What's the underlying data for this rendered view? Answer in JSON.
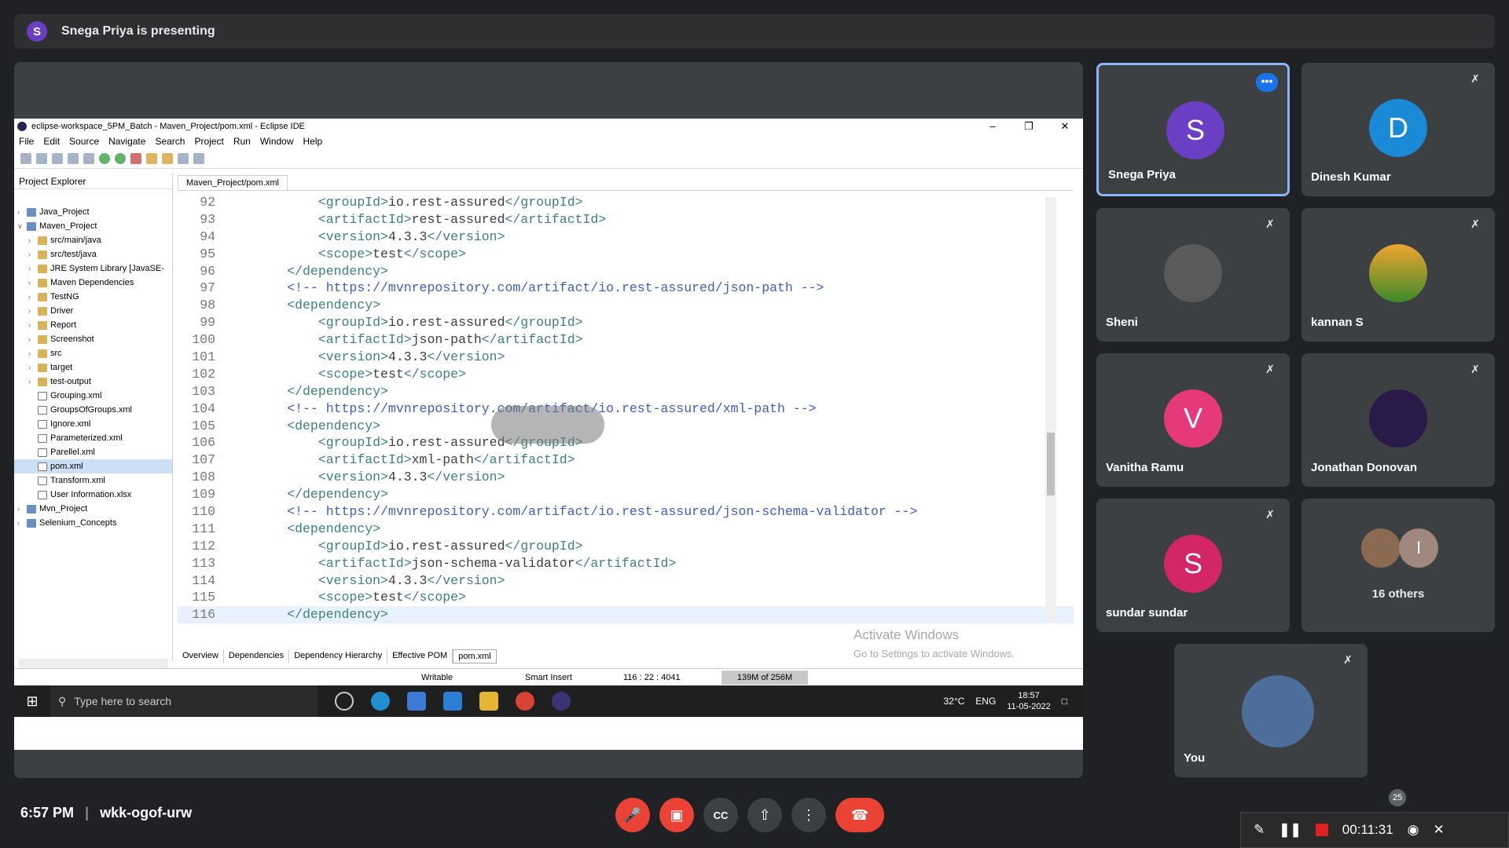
{
  "banner": {
    "avatar_letter": "S",
    "text": "Snega Priya is presenting"
  },
  "eclipse": {
    "title": "eclipse-workspace_5PM_Batch - Maven_Project/pom.xml - Eclipse IDE",
    "menu": [
      "File",
      "Edit",
      "Source",
      "Navigate",
      "Search",
      "Project",
      "Run",
      "Window",
      "Help"
    ],
    "explorer_title": "Project Explorer",
    "tree": [
      {
        "label": "Java_Project",
        "level": 0,
        "icon": "project"
      },
      {
        "label": "Maven_Project",
        "level": 0,
        "icon": "project"
      },
      {
        "label": "src/main/java",
        "level": 1,
        "icon": "package"
      },
      {
        "label": "src/test/java",
        "level": 1,
        "icon": "package"
      },
      {
        "label": "JRE System Library [JavaSE-",
        "level": 1,
        "icon": "library"
      },
      {
        "label": "Maven Dependencies",
        "level": 1,
        "icon": "library"
      },
      {
        "label": "TestNG",
        "level": 1,
        "icon": "library"
      },
      {
        "label": "Driver",
        "level": 1,
        "icon": "folder"
      },
      {
        "label": "Report",
        "level": 1,
        "icon": "folder"
      },
      {
        "label": "Screenshot",
        "level": 1,
        "icon": "folder"
      },
      {
        "label": "src",
        "level": 1,
        "icon": "folder"
      },
      {
        "label": "target",
        "level": 1,
        "icon": "folder"
      },
      {
        "label": "test-output",
        "level": 1,
        "icon": "folder"
      },
      {
        "label": "Grouping.xml",
        "level": 1,
        "icon": "file"
      },
      {
        "label": "GroupsOfGroups.xml",
        "level": 1,
        "icon": "file"
      },
      {
        "label": "Ignore.xml",
        "level": 1,
        "icon": "file"
      },
      {
        "label": "Parameterized.xml",
        "level": 1,
        "icon": "file"
      },
      {
        "label": "Parellel.xml",
        "level": 1,
        "icon": "file"
      },
      {
        "label": "pom.xml",
        "level": 1,
        "icon": "file",
        "selected": true
      },
      {
        "label": "Transform.xml",
        "level": 1,
        "icon": "file"
      },
      {
        "label": "User Information.xlsx",
        "level": 1,
        "icon": "file"
      },
      {
        "label": "Mvn_Project",
        "level": 0,
        "icon": "project"
      },
      {
        "label": "Selenium_Concepts",
        "level": 0,
        "icon": "project"
      }
    ],
    "editor_tab": "Maven_Project/pom.xml",
    "code": [
      {
        "n": "92",
        "t": "            <groupId>io.rest-assured</groupId>"
      },
      {
        "n": "93",
        "t": "            <artifactId>rest-assured</artifactId>"
      },
      {
        "n": "94",
        "t": "            <version>4.3.3</version>"
      },
      {
        "n": "95",
        "t": "            <scope>test</scope>"
      },
      {
        "n": "96",
        "t": "        </dependency>"
      },
      {
        "n": "97",
        "t": "        <!-- https://mvnrepository.com/artifact/io.rest-assured/json-path -->"
      },
      {
        "n": "98",
        "t": "        <dependency>"
      },
      {
        "n": "99",
        "t": "            <groupId>io.rest-assured</groupId>"
      },
      {
        "n": "100",
        "t": "            <artifactId>json-path</artifactId>"
      },
      {
        "n": "101",
        "t": "            <version>4.3.3</version>"
      },
      {
        "n": "102",
        "t": "            <scope>test</scope>"
      },
      {
        "n": "103",
        "t": "        </dependency>"
      },
      {
        "n": "104",
        "t": "        <!-- https://mvnrepository.com/artifact/io.rest-assured/xml-path -->"
      },
      {
        "n": "105",
        "t": "        <dependency>"
      },
      {
        "n": "106",
        "t": "            <groupId>io.rest-assured</groupId>"
      },
      {
        "n": "107",
        "t": "            <artifactId>xml-path</artifactId>"
      },
      {
        "n": "108",
        "t": "            <version>4.3.3</version>"
      },
      {
        "n": "109",
        "t": "        </dependency>"
      },
      {
        "n": "110",
        "t": "        <!-- https://mvnrepository.com/artifact/io.rest-assured/json-schema-validator -->"
      },
      {
        "n": "111",
        "t": "        <dependency>"
      },
      {
        "n": "112",
        "t": "            <groupId>io.rest-assured</groupId>"
      },
      {
        "n": "113",
        "t": "            <artifactId>json-schema-validator</artifactId>"
      },
      {
        "n": "114",
        "t": "            <version>4.3.3</version>"
      },
      {
        "n": "115",
        "t": "            <scope>test</scope>"
      },
      {
        "n": "116",
        "t": "        </dependency>"
      }
    ],
    "bottom_tabs": [
      "Overview",
      "Dependencies",
      "Dependency Hierarchy",
      "Effective POM",
      "pom.xml"
    ],
    "status": {
      "mode": "Writable",
      "insert": "Smart Insert",
      "position": "116 : 22 : 4041",
      "memory": "139M of 256M"
    },
    "watermark": {
      "title": "Activate Windows",
      "sub": "Go to Settings to activate Windows."
    }
  },
  "taskbar": {
    "search_placeholder": "Type here to search",
    "weather": "32°C",
    "lang": "ENG",
    "time": "18:57",
    "date": "11-05-2022"
  },
  "participants": [
    {
      "name": "Snega Priya",
      "letter": "S",
      "color": "#6a3fc4",
      "active": true
    },
    {
      "name": "Dinesh Kumar",
      "letter": "D",
      "color": "#1a8ad6"
    },
    {
      "name": "Sheni",
      "letter": "",
      "color": "#555555"
    },
    {
      "name": "kannan S",
      "letter": "",
      "color": "#b8862c"
    },
    {
      "name": "Vanitha Ramu",
      "letter": "V",
      "color": "#e5397a"
    },
    {
      "name": "Jonathan Donovan",
      "letter": "",
      "color": "#2a1a4a"
    },
    {
      "name": "sundar sundar",
      "letter": "S",
      "color": "#d3266a"
    }
  ],
  "others": {
    "label": "16 others",
    "letter": "I"
  },
  "self": {
    "name": "You"
  },
  "meeting": {
    "time": "6:57 PM",
    "code": "wkk-ogof-urw",
    "participant_count": "25"
  },
  "recording": {
    "timer": "00:11:31"
  }
}
